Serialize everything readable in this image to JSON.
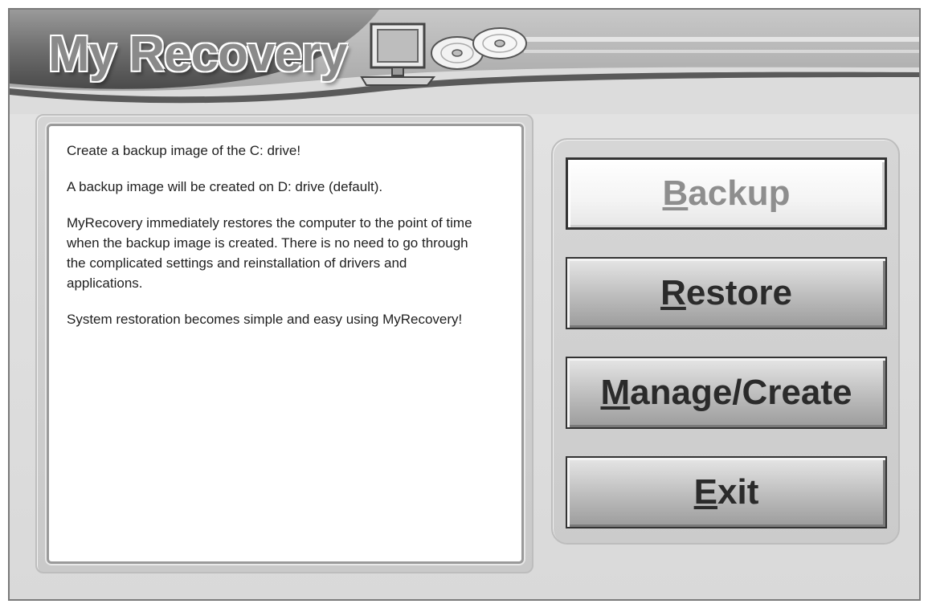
{
  "app": {
    "title": "My Recovery"
  },
  "description": {
    "paragraphs": [
      "Create a backup image of the C: drive!",
      "A backup image will be created on D: drive (default).",
      "MyRecovery immediately restores the computer to the point of time when the backup image is created.  There is no need to go through the complicated settings and reinstallation of drivers and applications.",
      "System restoration becomes simple and easy using MyRecovery!"
    ]
  },
  "buttons": {
    "backup": {
      "accel": "B",
      "rest": "ackup",
      "state": "disabled"
    },
    "restore": {
      "accel": "R",
      "rest": "estore"
    },
    "manage": {
      "accel": "M",
      "rest": "anage/Create"
    },
    "exit": {
      "accel": "E",
      "rest": "xit"
    }
  },
  "icons": {
    "monitor": "computer-monitor-icon",
    "discs": "cd-disc-icon"
  },
  "colors": {
    "window_bg": "#d9d9d9",
    "button_text": "#2b2b2b",
    "disabled_text": "#8e8e8e"
  }
}
